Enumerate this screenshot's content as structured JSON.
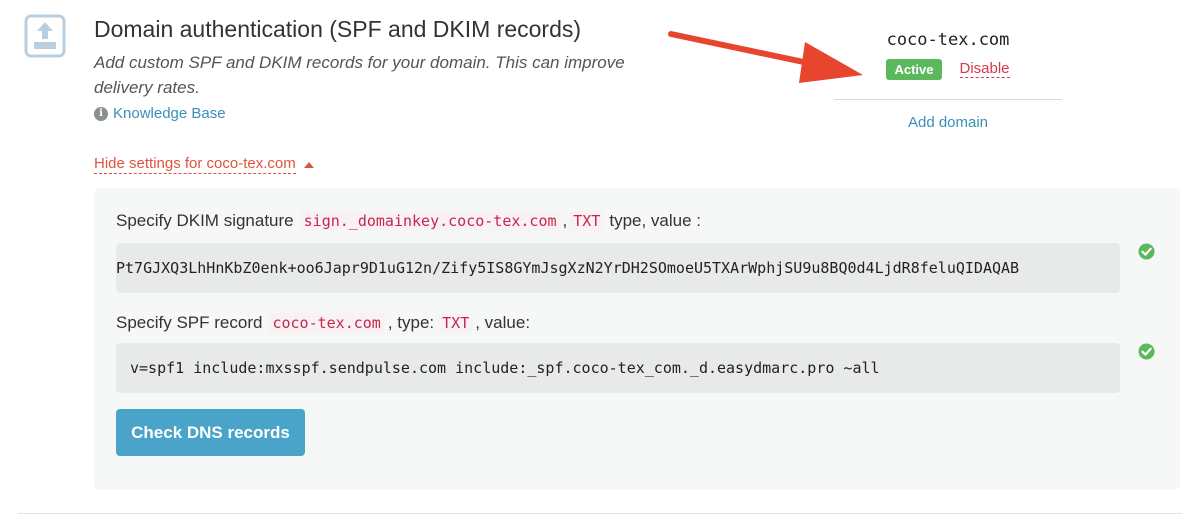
{
  "header": {
    "title": "Domain authentication (SPF and DKIM records)",
    "description": "Add custom SPF and DKIM records for your domain. This can improve delivery rates.",
    "knowledge_base_label": "Knowledge Base",
    "section_icon": "upload-icon"
  },
  "settings_toggle": {
    "label": "Hide settings for coco-tex.com",
    "icon": "caret-up-icon"
  },
  "domain_panel": {
    "domain": "coco-tex.com",
    "status_badge": "Active",
    "disable_label": "Disable",
    "add_domain_label": "Add domain"
  },
  "dkim": {
    "label_prefix": "Specify DKIM signature",
    "host": "sign._domainkey.coco-tex.com",
    "separator": ",",
    "record_type": "TXT",
    "label_suffix": "type, value :",
    "value": "Pt7GJXQ3LhHnKbZ0enk+oo6Japr9D1uG12n/Zify5IS8GYmJsgXzN2YrDH2SOmoeU5TXArWphjSU9u8BQ0d4LjdR8feluQIDAQAB"
  },
  "spf": {
    "label_prefix": "Specify SPF record",
    "host": "coco-tex.com",
    "separator": ", type:",
    "record_type": "TXT",
    "label_suffix": ", value:",
    "value": "v=spf1 include:mxsspf.sendpulse.com include:_spf.coco-tex_com._d.easydmarc.pro ~all"
  },
  "actions": {
    "check_dns_label": "Check DNS records"
  },
  "colors": {
    "accent_blue": "#4aa3c9",
    "link_blue": "#3a8fb7",
    "success_green": "#5cb85c",
    "danger_red": "#d63a4a",
    "toggle_orange_red": "#e0533d",
    "annotation_arrow": "#e8452f"
  }
}
